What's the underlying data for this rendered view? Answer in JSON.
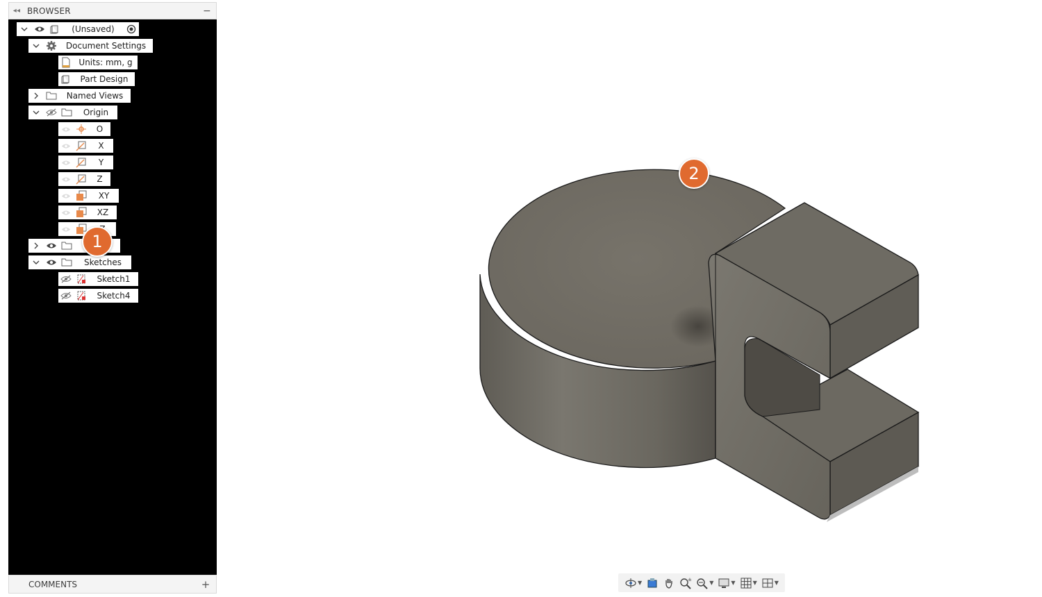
{
  "browser": {
    "title": "BROWSER",
    "collapse_glyph": "◂◂",
    "minimize_glyph": "−",
    "tree": {
      "root": {
        "label": "(Unsaved)"
      },
      "document_settings": {
        "label": "Document Settings"
      },
      "units": {
        "label": "Units: mm, g"
      },
      "part_design": {
        "label": "Part Design"
      },
      "named_views": {
        "label": "Named Views"
      },
      "origin": {
        "label": "Origin"
      },
      "origin_o": {
        "label": "O"
      },
      "origin_x": {
        "label": "X"
      },
      "origin_y": {
        "label": "Y"
      },
      "origin_z": {
        "label": "Z"
      },
      "origin_xy": {
        "label": "XY"
      },
      "origin_xz": {
        "label": "XZ"
      },
      "origin_yz": {
        "label": "Z"
      },
      "sketches": {
        "label": "Sketches"
      },
      "sketch1": {
        "label": "Sketch1"
      },
      "sketch4": {
        "label": "Sketch4"
      }
    }
  },
  "comments": {
    "title": "COMMENTS",
    "add_glyph": "+"
  },
  "badges": {
    "one": "1",
    "two": "2"
  },
  "colors": {
    "badge": "#e06a2f",
    "model_top": "#77736a",
    "model_side": "#6e6b63",
    "tree_bg": "#000000",
    "origin_orange": "#e8894a"
  },
  "navbar": {
    "tools": [
      "orbit-icon",
      "look-at-icon",
      "pan-icon",
      "zoom-icon",
      "fit-icon",
      "display-settings-icon",
      "grid-icon",
      "viewports-icon"
    ]
  }
}
